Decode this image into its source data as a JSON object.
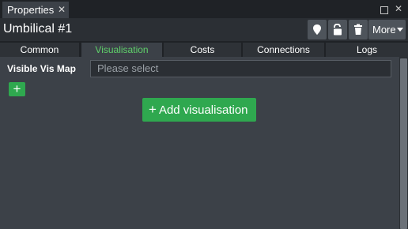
{
  "panel_tab": {
    "label": "Properties",
    "close_glyph": "✕"
  },
  "window_controls": {
    "restore_icon": "restore-icon",
    "close_glyph": "✕"
  },
  "header": {
    "title": "Umbilical #1",
    "icons": [
      "map-pin-icon",
      "unlock-icon",
      "trash-icon"
    ],
    "more_label": "More"
  },
  "tabs": [
    {
      "label": "Common",
      "active": false
    },
    {
      "label": "Visualisation",
      "active": true
    },
    {
      "label": "Costs",
      "active": false
    },
    {
      "label": "Connections",
      "active": false
    },
    {
      "label": "Logs",
      "active": false
    }
  ],
  "visualisation": {
    "field_label": "Visible Vis Map",
    "select_placeholder": "Please select",
    "add_small_glyph": "+",
    "add_button_label": "Add visualisation",
    "add_button_glyph": "+"
  },
  "colors": {
    "accent_green": "#2fa84f",
    "active_tab_text": "#5fd06a",
    "panel_bg": "#3c4148"
  }
}
